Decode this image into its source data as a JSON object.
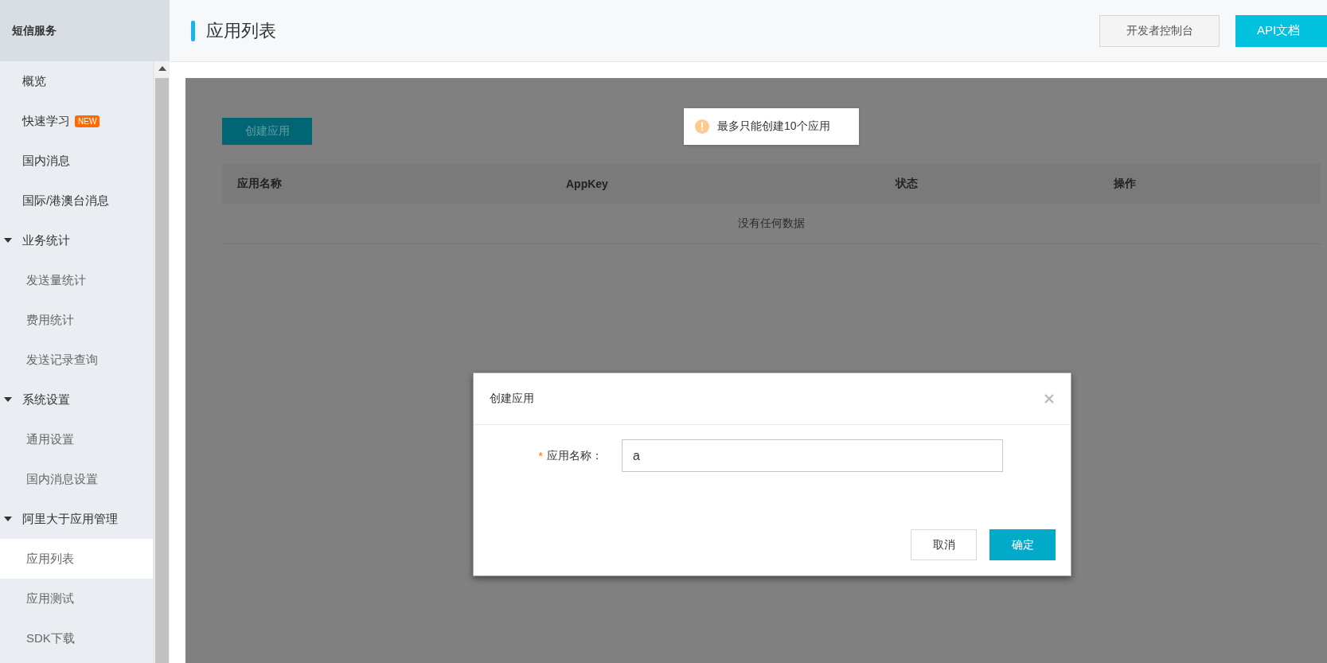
{
  "sidebar": {
    "title": "短信服务",
    "items": [
      {
        "label": "概览",
        "kind": "item",
        "selected": false
      },
      {
        "label": "快速学习",
        "kind": "item",
        "badge": "NEW",
        "selected": false
      },
      {
        "label": "国内消息",
        "kind": "item",
        "selected": false
      },
      {
        "label": "国际/港澳台消息",
        "kind": "item",
        "selected": false
      },
      {
        "label": "业务统计",
        "kind": "group",
        "expanded": true,
        "children": [
          {
            "label": "发送量统计",
            "selected": false
          },
          {
            "label": "费用统计",
            "selected": false
          },
          {
            "label": "发送记录查询",
            "selected": false
          }
        ]
      },
      {
        "label": "系统设置",
        "kind": "group",
        "expanded": true,
        "children": [
          {
            "label": "通用设置",
            "selected": false
          },
          {
            "label": "国内消息设置",
            "selected": false
          }
        ]
      },
      {
        "label": "阿里大于应用管理",
        "kind": "group",
        "expanded": true,
        "children": [
          {
            "label": "应用列表",
            "selected": true
          },
          {
            "label": "应用测试",
            "selected": false
          },
          {
            "label": "SDK下载",
            "selected": false
          }
        ]
      }
    ]
  },
  "header": {
    "title": "应用列表",
    "buttons": [
      {
        "label": "开发者控制台",
        "kind": "secondary"
      },
      {
        "label": "API文档",
        "kind": "primary"
      }
    ]
  },
  "content": {
    "create_button": "创建应用",
    "table": {
      "columns": [
        "应用名称",
        "AppKey",
        "状态",
        "操作"
      ],
      "empty_text": "没有任何数据"
    }
  },
  "toast": {
    "kind": "warning",
    "text": "最多只能创建10个应用"
  },
  "dialog": {
    "title": "创建应用",
    "field": {
      "label": "应用名称：",
      "required_mark": "*",
      "value": "a"
    },
    "buttons": [
      {
        "label": "取消",
        "kind": "secondary"
      },
      {
        "label": "确定",
        "kind": "primary"
      }
    ]
  }
}
